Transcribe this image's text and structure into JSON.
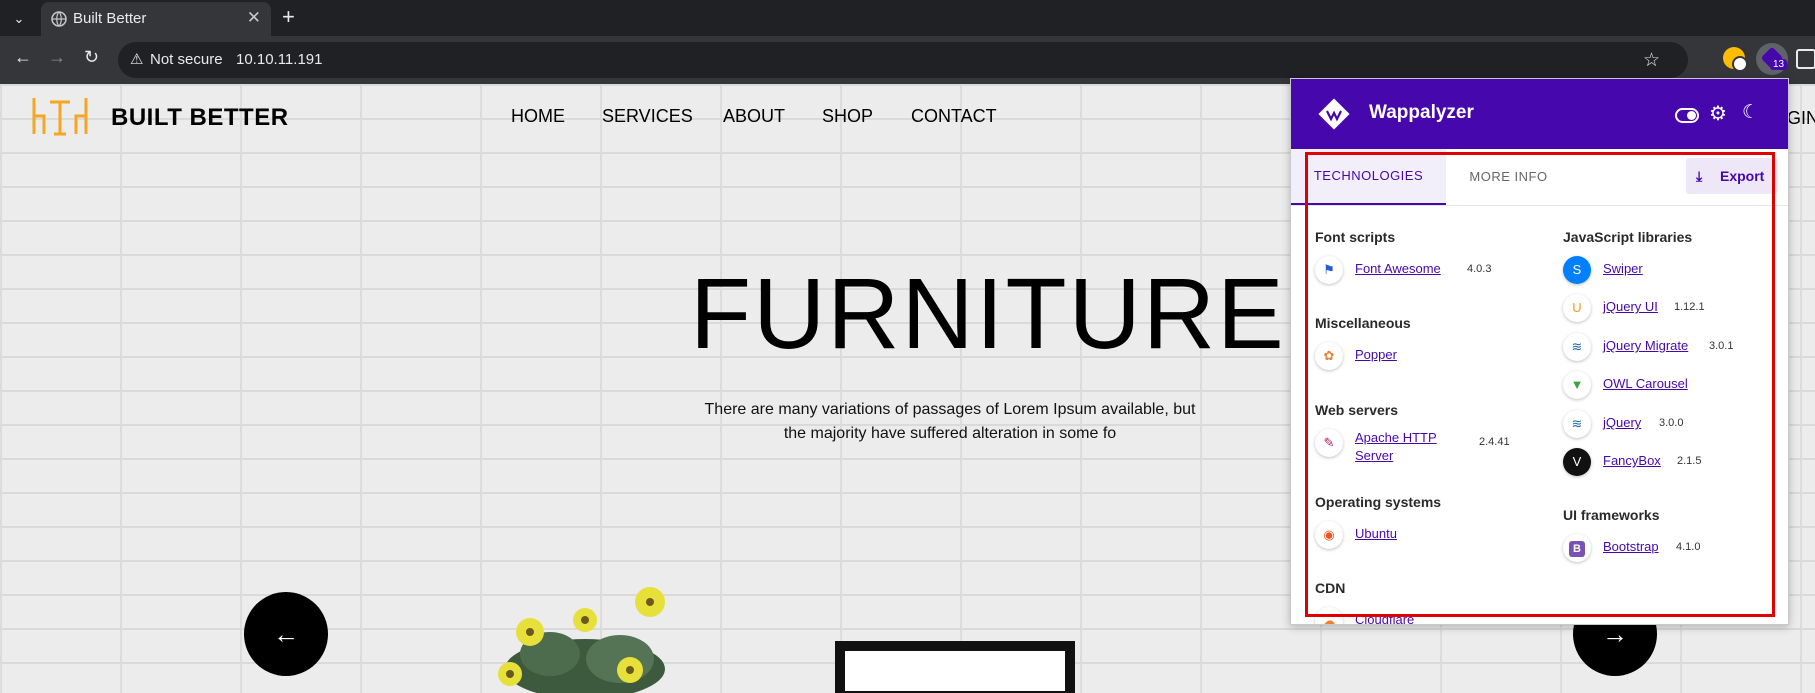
{
  "browser": {
    "tab_title": "Built Better",
    "tab_close": "✕",
    "new_tab": "+",
    "security_label": "Not secure",
    "url": "10.10.11.191",
    "extension_badge": "13"
  },
  "site": {
    "brand": "BUILT BETTER",
    "nav": [
      "HOME",
      "SERVICES",
      "ABOUT",
      "SHOP",
      "CONTACT"
    ],
    "nav_fragment": "GIN",
    "hero_title": "FURNITURE",
    "hero_text_line1": "There are many variations of passages of Lorem Ipsum available, but",
    "hero_text_line2": "the majority have suffered alteration in some fo",
    "prev_arrow": "←",
    "next_arrow": "→"
  },
  "wappalyzer": {
    "title": "Wappalyzer",
    "tabs": [
      "TECHNOLOGIES",
      "MORE INFO"
    ],
    "export_label": "Export",
    "left_column": [
      {
        "category": "Font scripts",
        "items": [
          {
            "name": "Font Awesome",
            "version": "4.0.3",
            "icon": "flag-icon"
          }
        ]
      },
      {
        "category": "Miscellaneous",
        "items": [
          {
            "name": "Popper",
            "version": "",
            "icon": "popper-icon"
          }
        ]
      },
      {
        "category": "Web servers",
        "items": [
          {
            "name": "Apache HTTP Server",
            "version": "2.4.41",
            "icon": "apache-feather-icon"
          }
        ]
      },
      {
        "category": "Operating systems",
        "items": [
          {
            "name": "Ubuntu",
            "version": "",
            "icon": "ubuntu-icon"
          }
        ]
      },
      {
        "category": "CDN",
        "items": [
          {
            "name": "Cloudflare",
            "version": "",
            "icon": "cloudflare-icon"
          }
        ]
      }
    ],
    "right_column": [
      {
        "category": "JavaScript libraries",
        "items": [
          {
            "name": "Swiper",
            "version": "",
            "icon": "swiper-icon"
          },
          {
            "name": "jQuery UI",
            "version": "1.12.1",
            "icon": "jquery-ui-icon"
          },
          {
            "name": "jQuery Migrate",
            "version": "3.0.1",
            "icon": "jquery-icon"
          },
          {
            "name": "OWL Carousel",
            "version": "",
            "icon": "owl-carousel-icon"
          },
          {
            "name": "jQuery",
            "version": "3.0.0",
            "icon": "jquery-icon"
          },
          {
            "name": "FancyBox",
            "version": "2.1.5",
            "icon": "fancybox-icon"
          }
        ]
      },
      {
        "category": "UI frameworks",
        "items": [
          {
            "name": "Bootstrap",
            "version": "4.1.0",
            "icon": "bootstrap-icon"
          }
        ]
      }
    ]
  },
  "colors": {
    "wappalyzer_purple": "#4608ad",
    "highlight_red": "#e00000",
    "logo_orange": "#f5a623"
  }
}
